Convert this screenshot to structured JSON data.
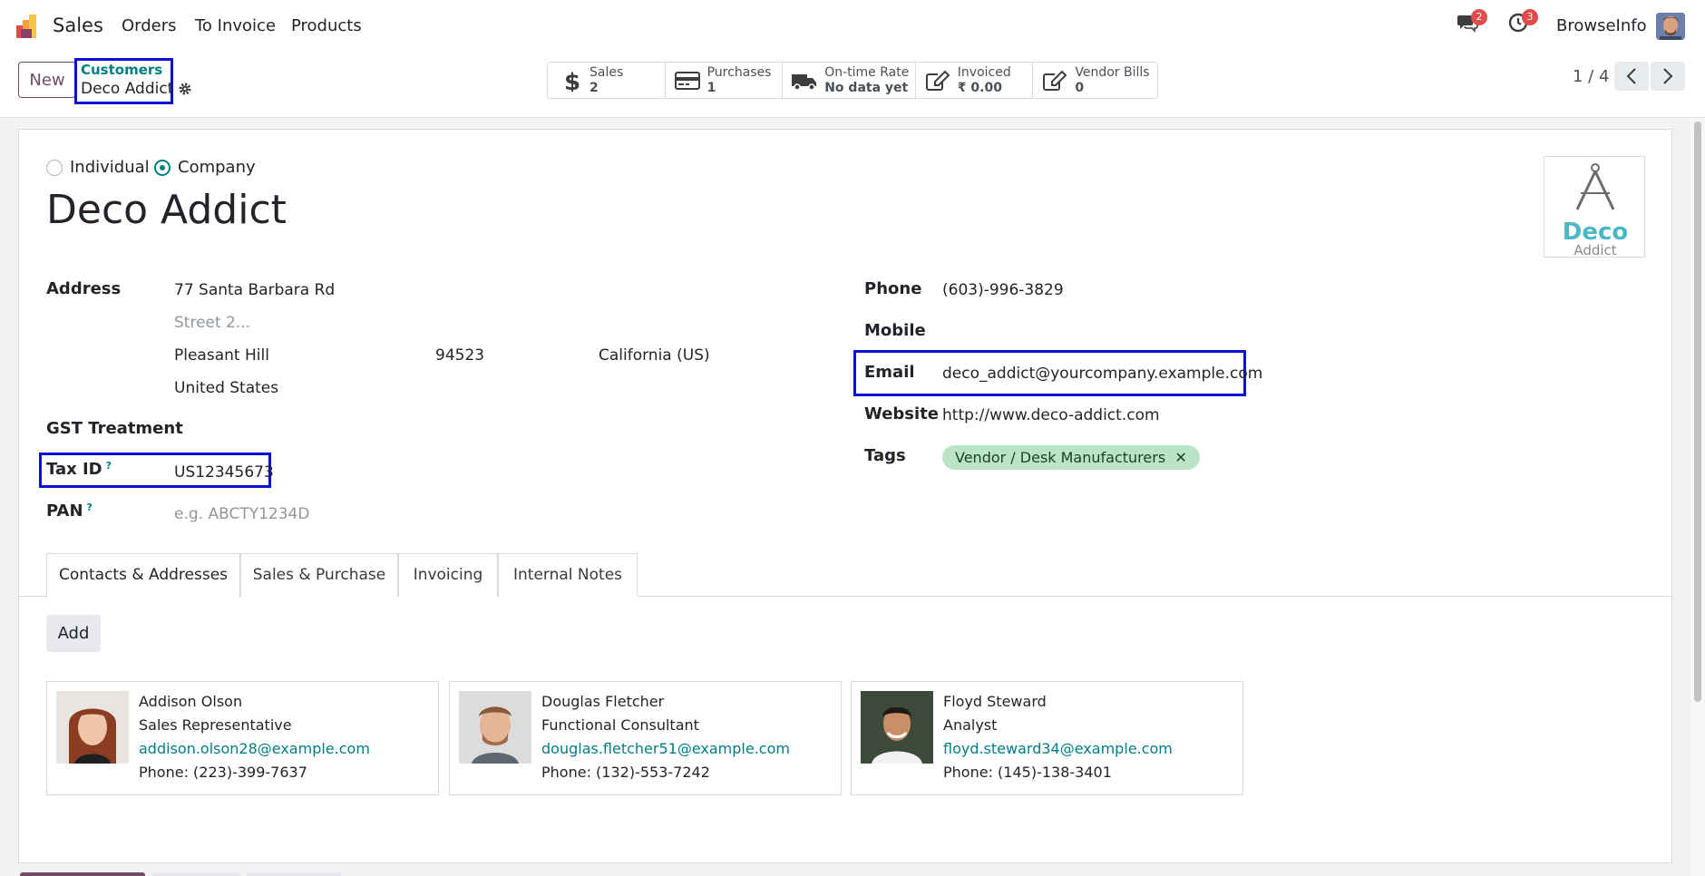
{
  "topbar": {
    "app_name": "Sales",
    "menu": [
      "Orders",
      "To Invoice",
      "Products"
    ],
    "messages_count": "2",
    "activities_count": "3",
    "user_name": "BrowseInfo"
  },
  "control": {
    "new_label": "New",
    "breadcrumb_parent": "Customers",
    "breadcrumb_current": "Deco Addict",
    "pager": "1 / 4"
  },
  "smart_buttons": [
    {
      "label": "Sales",
      "value": "2",
      "icon": "dollar-icon"
    },
    {
      "label": "Purchases",
      "value": "1",
      "icon": "credit-card-icon"
    },
    {
      "label": "On-time Rate",
      "value": "No data yet",
      "icon": "truck-icon"
    },
    {
      "label": "Invoiced",
      "value": "₹ 0.00",
      "icon": "pencil-square-icon"
    },
    {
      "label": "Vendor Bills",
      "value": "0",
      "icon": "pencil-square-icon"
    }
  ],
  "form": {
    "type_individual": "Individual",
    "type_company": "Company",
    "name": "Deco Addict",
    "logo_main": "Deco",
    "logo_sub": "Addict",
    "address_label": "Address",
    "street": "77 Santa Barbara Rd",
    "street2_placeholder": "Street 2...",
    "city": "Pleasant Hill",
    "zip": "94523",
    "state": "California (US)",
    "country": "United States",
    "gst_label": "GST Treatment",
    "tax_id_label": "Tax ID",
    "tax_id": "US12345673",
    "pan_label": "PAN",
    "pan_placeholder": "e.g. ABCTY1234D",
    "help_mark": "?",
    "phone_label": "Phone",
    "phone": "(603)-996-3829",
    "mobile_label": "Mobile",
    "email_label": "Email",
    "email": "deco_addict@yourcompany.example.com",
    "website_label": "Website",
    "website": "http://www.deco-addict.com",
    "tags_label": "Tags",
    "tag": "Vendor / Desk Manufacturers",
    "tag_remove": "✕"
  },
  "tabs": [
    "Contacts & Addresses",
    "Sales & Purchase",
    "Invoicing",
    "Internal Notes"
  ],
  "contacts": {
    "add_label": "Add",
    "items": [
      {
        "name": "Addison Olson",
        "role": "Sales Representative",
        "email": "addison.olson28@example.com",
        "phone": "Phone: (223)-399-7637"
      },
      {
        "name": "Douglas Fletcher",
        "role": "Functional Consultant",
        "email": "douglas.fletcher51@example.com",
        "phone": "Phone: (132)-553-7242"
      },
      {
        "name": "Floyd Steward",
        "role": "Analyst",
        "email": "floyd.steward34@example.com",
        "phone": "Phone: (145)-138-3401"
      }
    ]
  },
  "colors": {
    "primary": "#714b67",
    "accent": "#017e84",
    "highlight": "#0b10d4",
    "tag_bg": "#b9e5c6"
  }
}
